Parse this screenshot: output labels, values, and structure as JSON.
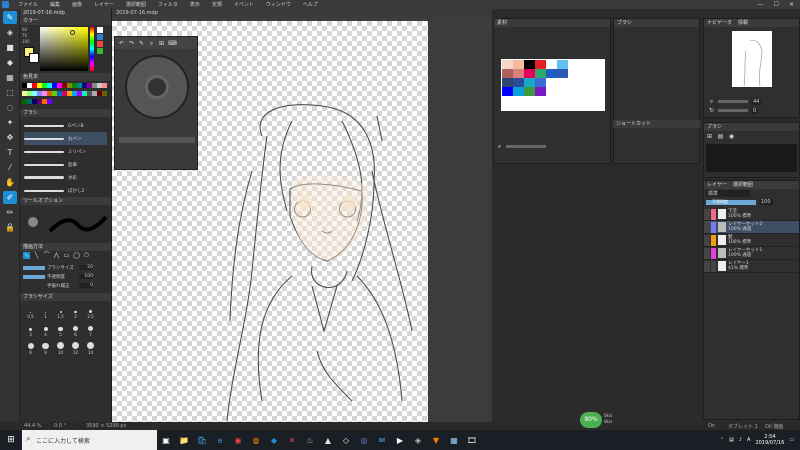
{
  "menubar": {
    "items": [
      "ファイル",
      "編集",
      "画像",
      "レイヤー",
      "選択範囲",
      "フィルタ",
      "表示",
      "定規",
      "イベント",
      "ウィンドウ",
      "ヘルプ"
    ],
    "window_buttons": [
      "—",
      "☐",
      "✕"
    ]
  },
  "left_toolbar": {
    "tools": [
      "brush-icon",
      "eraser-icon",
      "rect-icon",
      "fill-icon",
      "gradient-icon",
      "select-icon",
      "lasso-icon",
      "magic-wand-icon",
      "move-icon",
      "text-icon",
      "eyedropper-icon",
      "hand-icon",
      "pen-active-icon",
      "pen-icon",
      "lock-icon"
    ]
  },
  "doc_tab": {
    "title": "2019-07-16.mdp"
  },
  "color_panel": {
    "title": "カラー",
    "hsv": {
      "h": "60",
      "s": "70",
      "v": "100"
    },
    "fg_color": "#f6ee80",
    "bg_color": "#ffffff"
  },
  "color_set": {
    "title": "色見本"
  },
  "brush_panel": {
    "title": "ブラシ",
    "items": [
      {
        "name": "GペンB",
        "size": ""
      },
      {
        "name": "丸ペン",
        "size": ""
      },
      {
        "name": "ミリペン",
        "size": ""
      },
      {
        "name": "鉛筆",
        "size": ""
      },
      {
        "name": "水彩",
        "size": ""
      },
      {
        "name": "ぼかし2",
        "size": ""
      }
    ]
  },
  "tool_options": {
    "title": "ツールオプション",
    "brush_size_label": "ブラシサイズ",
    "brush_size": "20",
    "opacity_label": "不透明度",
    "opacity": "100",
    "stabilizer_label": "手振れ補正",
    "stabilizer": "0"
  },
  "drawing_mode_label": "描画方法",
  "brush_size_panel": {
    "title": "ブラシサイズ",
    "sizes": [
      "0.5",
      "1",
      "1.5",
      "2",
      "2.5",
      "3",
      "4",
      "5",
      "6",
      "7",
      "8",
      "9",
      "10",
      "12",
      "14"
    ]
  },
  "material_panel": {
    "title": "素材",
    "swatches": [
      "#f7d7c4",
      "#f5b99c",
      "#000000",
      "#e31e26",
      "#ffffff",
      "#5ec1f0",
      "#b15e5e",
      "#d77d7d",
      "#e5005a",
      "#2ea76a",
      "#1e5fc2",
      "#2b59b4",
      "#2d4673",
      "#2b4b9b",
      "#1aa7c8",
      "#3a6ed6",
      "#ffffff",
      "#ffffff",
      "#0000ff",
      "#0aa2d6",
      "#3e9a3d",
      "#7719c3",
      "#ffffff",
      "#ffffff"
    ]
  },
  "brush_window_title": "ブラシ",
  "navigator": {
    "title": "ナビゲータ",
    "tab2": "情報",
    "zoom": "44",
    "angle": "0"
  },
  "shortcut_panel": {
    "title": "ショートカット"
  },
  "layers": {
    "title": "レイヤー",
    "tab2": "選択範囲",
    "blend": "標準",
    "opacity_label": "不透明度",
    "opacity": "100",
    "items": [
      {
        "name": "下塗",
        "info": "100% 標準",
        "color": "#f06a8a",
        "selected": false,
        "folder": false
      },
      {
        "name": "レイヤーセット2",
        "info": "100% 通過",
        "color": "#7b7bf0",
        "selected": true,
        "folder": true
      },
      {
        "name": "髪",
        "info": "100% 標準",
        "color": "#f39c12",
        "selected": false,
        "folder": false
      },
      {
        "name": "レイヤーセット1",
        "info": "100% 通過",
        "color": "#e040e0",
        "selected": false,
        "folder": true
      },
      {
        "name": "レイヤー1",
        "info": "41% 標準",
        "color": "#444444",
        "selected": false,
        "folder": false
      }
    ]
  },
  "statusbar": {
    "zoom": "44.4 %",
    "angle": "0.0 °",
    "size": "3590 × 5290 px",
    "on_label": "On",
    "tablet": "タブレット 1",
    "oil": "Oil 描画"
  },
  "perf": {
    "cpu": "80%",
    "up": "0k/s",
    "down": "0k/s"
  },
  "taskbar": {
    "search_placeholder": "ここに入力して検索",
    "time": "2:54",
    "date": "2019/07/16",
    "icons": [
      "task-view-icon",
      "explorer-icon",
      "store-icon",
      "edge-icon",
      "chrome-icon",
      "firefox-icon",
      "medibang-icon",
      "xmind-icon",
      "steam-icon",
      "app-icon-1",
      "app-icon-2",
      "discord-icon",
      "mail-icon",
      "app-icon-3",
      "app-icon-4",
      "vlc-icon",
      "app-icon-5",
      "film-icon"
    ]
  }
}
